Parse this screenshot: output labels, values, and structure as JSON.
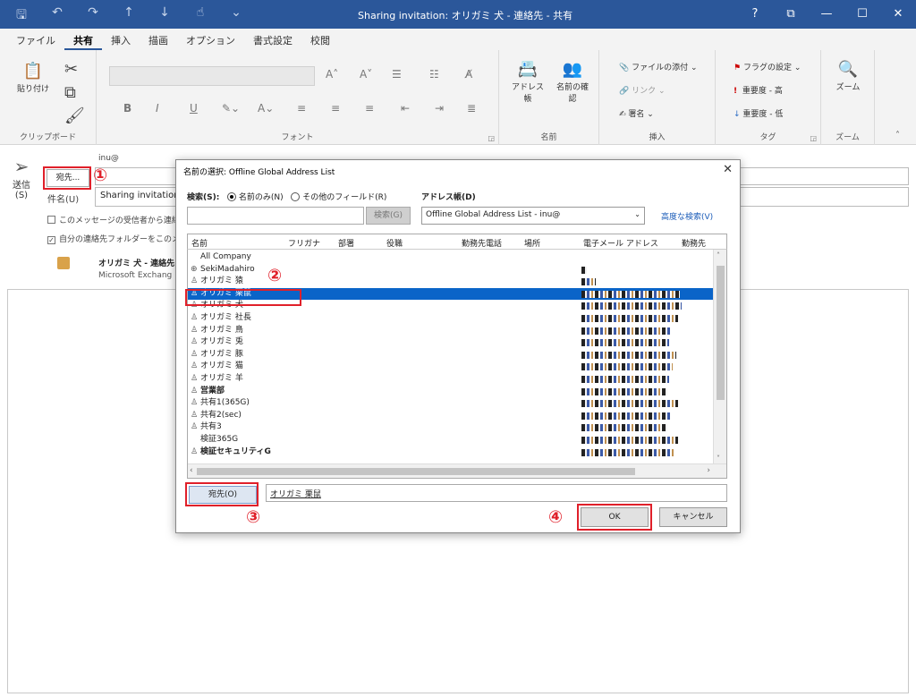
{
  "window": {
    "title": "Sharing invitation: オリガミ 犬 - 連絡先 - 共有",
    "buttons": {
      "help": "?",
      "restore": "⧉",
      "minimize": "—",
      "maximize": "☐",
      "close": "✕"
    }
  },
  "ribbon": {
    "tabs": [
      "ファイル",
      "共有",
      "挿入",
      "描画",
      "オプション",
      "書式設定",
      "校閲"
    ],
    "active_tab": "共有",
    "groups": {
      "clipboard": {
        "label": "クリップボード",
        "paste": "貼り付け"
      },
      "font": {
        "label": "フォント"
      },
      "names": {
        "label": "名前",
        "address_book": "アドレス帳",
        "check_names": "名前の確認"
      },
      "insert": {
        "label": "挿入",
        "attach": "ファイルの添付 ⌄",
        "link": "リンク ⌄",
        "signature": "署名 ⌄"
      },
      "tags": {
        "label": "タグ",
        "flag": "フラグの設定 ⌄",
        "high": "重要度 - 高",
        "low": "重要度 - 低"
      },
      "zoom": {
        "label": "ズーム",
        "zoom": "ズーム"
      }
    }
  },
  "message": {
    "send_label": "送信",
    "send_key": "(S)",
    "to_button": "宛先...",
    "from_text": "inu@",
    "subject_label": "件名(U)",
    "subject_value": "Sharing invitation",
    "checkbox1": "このメッセージの受信者から連絡",
    "checkbox2": "自分の連絡先フォルダーをこのメ",
    "contact_name": "オリガミ 犬 - 連絡先",
    "contact_sub": "Microsoft Exchang"
  },
  "dialog": {
    "title": "名前の選択: Offline Global Address List",
    "search_label": "検索(S):",
    "radio_name_only": "名前のみ(N)",
    "radio_other_fields": "その他のフィールド(R)",
    "address_book_label": "アドレス帳(D)",
    "search_button": "検索(G)",
    "address_book_value": "Offline Global Address List - inu@",
    "advanced_search": "高度な検索(V)",
    "columns": [
      "名前",
      "フリガナ",
      "部署",
      "役職",
      "勤務先電話",
      "場所",
      "電子メール アドレス",
      "勤務先"
    ],
    "rows": [
      {
        "name": "All Company",
        "icon": "",
        "bold": false,
        "selected": false
      },
      {
        "name": "SekiMadahiro",
        "icon": "⊕",
        "bold": false,
        "selected": false
      },
      {
        "name": "オリガミ 猿",
        "icon": "♙",
        "bold": false,
        "selected": false
      },
      {
        "name": "オリガミ 栗鼠",
        "icon": "♙",
        "bold": false,
        "selected": true
      },
      {
        "name": "オリガミ 犬",
        "icon": "♙",
        "bold": false,
        "selected": false
      },
      {
        "name": "オリガミ 社長",
        "icon": "♙",
        "bold": false,
        "selected": false
      },
      {
        "name": "オリガミ 鳥",
        "icon": "♙",
        "bold": false,
        "selected": false
      },
      {
        "name": "オリガミ 兎",
        "icon": "♙",
        "bold": false,
        "selected": false
      },
      {
        "name": "オリガミ 豚",
        "icon": "♙",
        "bold": false,
        "selected": false
      },
      {
        "name": "オリガミ 猫",
        "icon": "♙",
        "bold": false,
        "selected": false
      },
      {
        "name": "オリガミ 羊",
        "icon": "♙",
        "bold": false,
        "selected": false
      },
      {
        "name": "営業部",
        "icon": "♙",
        "bold": true,
        "selected": false
      },
      {
        "name": "共有1(365G)",
        "icon": "♙",
        "bold": false,
        "selected": false
      },
      {
        "name": "共有2(sec)",
        "icon": "♙",
        "bold": false,
        "selected": false
      },
      {
        "name": "共有3",
        "icon": "♙",
        "bold": false,
        "selected": false
      },
      {
        "name": "検証365G",
        "icon": "",
        "bold": false,
        "selected": false
      },
      {
        "name": "検証セキュリティG",
        "icon": "♙",
        "bold": true,
        "selected": false
      }
    ],
    "to_button": "宛先(O)",
    "to_value": "オリガミ 栗鼠",
    "ok": "OK",
    "cancel": "キャンセル"
  },
  "annotations": {
    "n1": "①",
    "n2": "②",
    "n3": "③",
    "n4": "④"
  },
  "colors": {
    "title_bar": "#2b579a",
    "selection": "#0a64c8",
    "annotation": "#e0202a"
  }
}
